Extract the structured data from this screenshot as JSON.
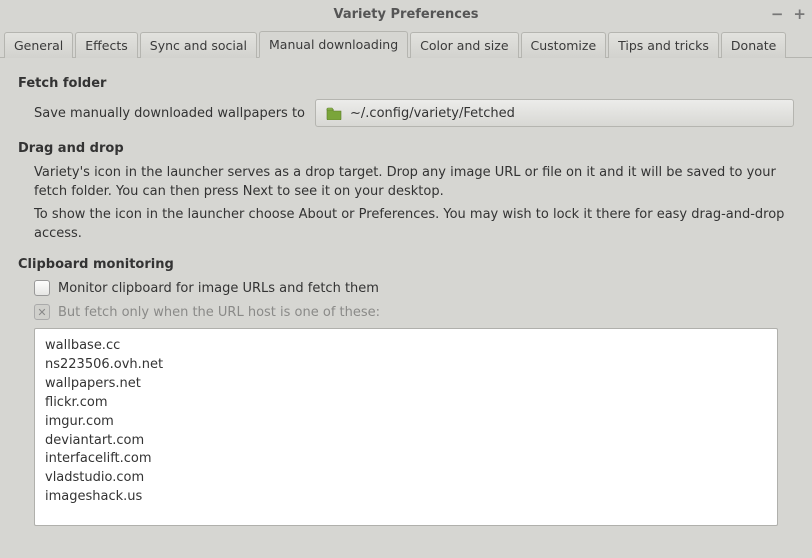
{
  "window": {
    "title": "Variety Preferences"
  },
  "tabs": [
    {
      "label": "General"
    },
    {
      "label": "Effects"
    },
    {
      "label": "Sync and social"
    },
    {
      "label": "Manual downloading"
    },
    {
      "label": "Color and size"
    },
    {
      "label": "Customize"
    },
    {
      "label": "Tips and tricks"
    },
    {
      "label": "Donate"
    }
  ],
  "sections": {
    "fetch": {
      "title": "Fetch folder",
      "save_label": "Save manually downloaded wallpapers to",
      "path": "~/.config/variety/Fetched"
    },
    "drag": {
      "title": "Drag and drop",
      "p1": "Variety's icon in the launcher serves as a drop target. Drop any image URL or file on it and it will be saved to your fetch folder. You can then press Next to see it on your desktop.",
      "p2": "To show the icon in the launcher choose About or Preferences. You may wish to lock it there for easy drag-and-drop access."
    },
    "clipboard": {
      "title": "Clipboard monitoring",
      "monitor_label": "Monitor clipboard for image URLs and fetch them",
      "filter_label": "But fetch only when the URL host is one of these:",
      "hosts": "wallbase.cc\nns223506.ovh.net\nwallpapers.net\nflickr.com\nimgur.com\ndeviantart.com\ninterfacelift.com\nvladstudio.com\nimageshack.us"
    }
  }
}
